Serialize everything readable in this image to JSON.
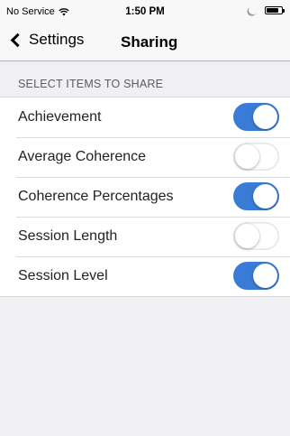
{
  "status_bar": {
    "carrier": "No Service",
    "time": "1:50 PM",
    "icons": [
      "wifi-icon",
      "moon-icon",
      "battery-icon"
    ],
    "battery_level": 0.8
  },
  "nav": {
    "back_label": "Settings",
    "title": "Sharing"
  },
  "section": {
    "header": "SELECT ITEMS TO SHARE"
  },
  "items": [
    {
      "label": "Achievement",
      "enabled": true
    },
    {
      "label": "Average Coherence",
      "enabled": false
    },
    {
      "label": "Coherence Percentages",
      "enabled": true
    },
    {
      "label": "Session Length",
      "enabled": false
    },
    {
      "label": "Session Level",
      "enabled": true
    }
  ],
  "colors": {
    "accent": "#3a7bd5",
    "background": "#efeff4"
  }
}
